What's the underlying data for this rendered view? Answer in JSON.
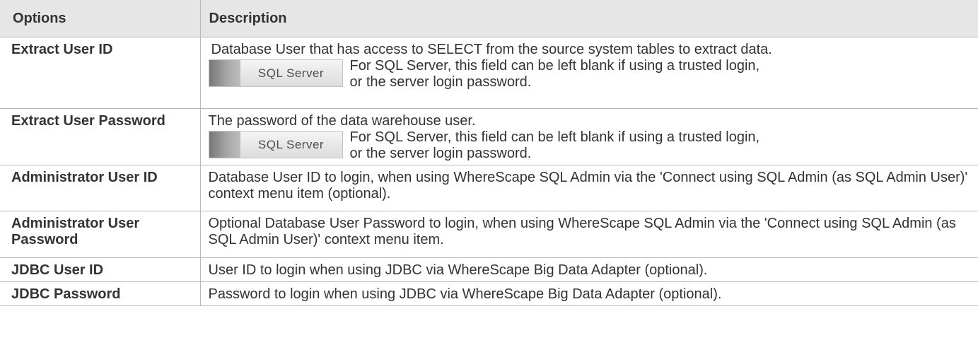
{
  "header": {
    "options": "Options",
    "description": "Description"
  },
  "rows": [
    {
      "option": "Extract User ID",
      "description": "Database User that has access to SELECT from the source system tables to extract data.",
      "badge": "SQL Server",
      "note": "For SQL Server, this field can be left blank if using a trusted login, or the server login password."
    },
    {
      "option": "Extract User Password",
      "description": "The password of the data warehouse user.",
      "badge": "SQL Server",
      "note": "For SQL Server, this field can be left blank if using a trusted login, or the server login password."
    },
    {
      "option": "Administrator User ID",
      "description": "Database User ID to login, when using WhereScape SQL Admin via the 'Connect using SQL Admin (as SQL Admin User)' context menu item (optional)."
    },
    {
      "option": "Administrator User Password",
      "description": "Optional Database User Password to login, when using WhereScape SQL Admin via the 'Connect using SQL Admin (as SQL Admin User)' context menu item."
    },
    {
      "option": "JDBC User ID",
      "description": "User ID to login when using JDBC via WhereScape Big Data Adapter (optional)."
    },
    {
      "option": "JDBC Password",
      "description": "Password to login when using JDBC via WhereScape Big Data Adapter (optional)."
    }
  ]
}
